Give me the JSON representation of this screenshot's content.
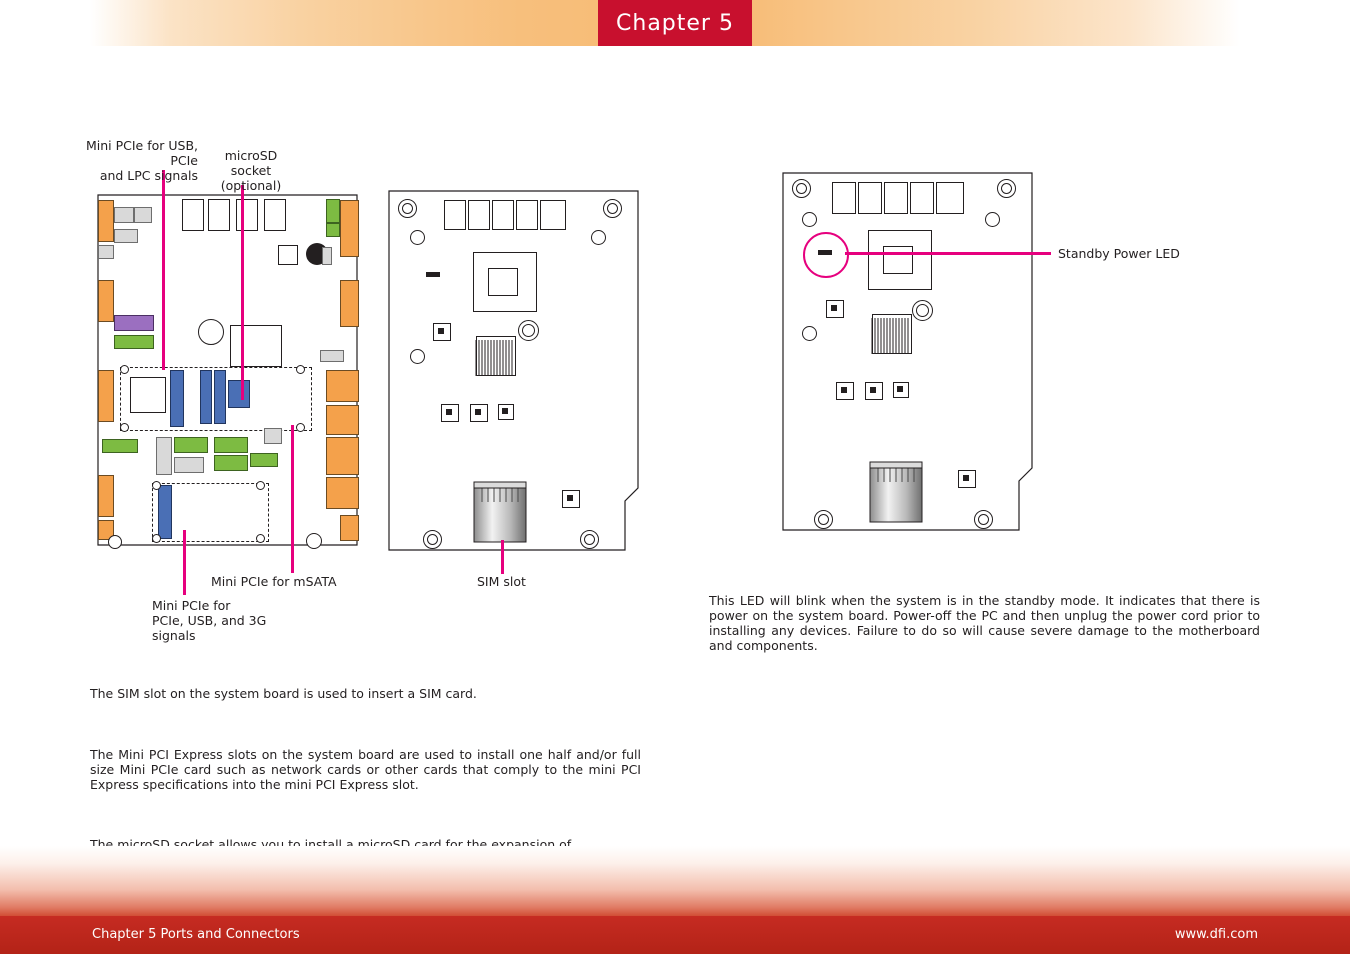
{
  "header": {
    "chapter": "Chapter 5"
  },
  "footer": {
    "left": "Chapter 5 Ports and Connectors",
    "right": "www.dfi.com"
  },
  "colors": {
    "accent_pink": "#e6007e",
    "tab_red": "#c8102e",
    "footer_red": "#b32317"
  },
  "callouts": {
    "minipcie_usb": "Mini PCIe for USB, PCIe\nand LPC signals",
    "minipcie_usb_l1": "Mini PCIe for USB, PCIe",
    "minipcie_usb_l2": "and LPC signals",
    "microsd_l1": "microSD socket",
    "microsd_l2": "(optional)",
    "msata": "Mini PCIe for mSATA",
    "sim_slot": "SIM slot",
    "pcie_usb_3g_l1": "Mini PCIe for",
    "pcie_usb_3g_l2": "PCIe, USB, and 3G",
    "pcie_usb_3g_l3": "signals",
    "standby_led": "Standby Power LED"
  },
  "body": {
    "standby_text": "This LED will blink when the system is in the standby mode. It indicates that there is power on the system board. Power-off the PC and then unplug the power cord prior to installing any devices. Failure to do so will cause severe damage to the motherboard and components.",
    "sim_text": "The SIM slot on the system board is used to insert a SIM card.",
    "minipcie_text": "The Mini PCI Express slots on the system board are used to install one half and/or full size Mini PCIe card such as network cards or other cards that comply to the mini PCI Express specifications into the mini PCI Express slot.",
    "microsd_text": "The microSD socket allows you to install a microSD card for the expansion of available memory."
  }
}
